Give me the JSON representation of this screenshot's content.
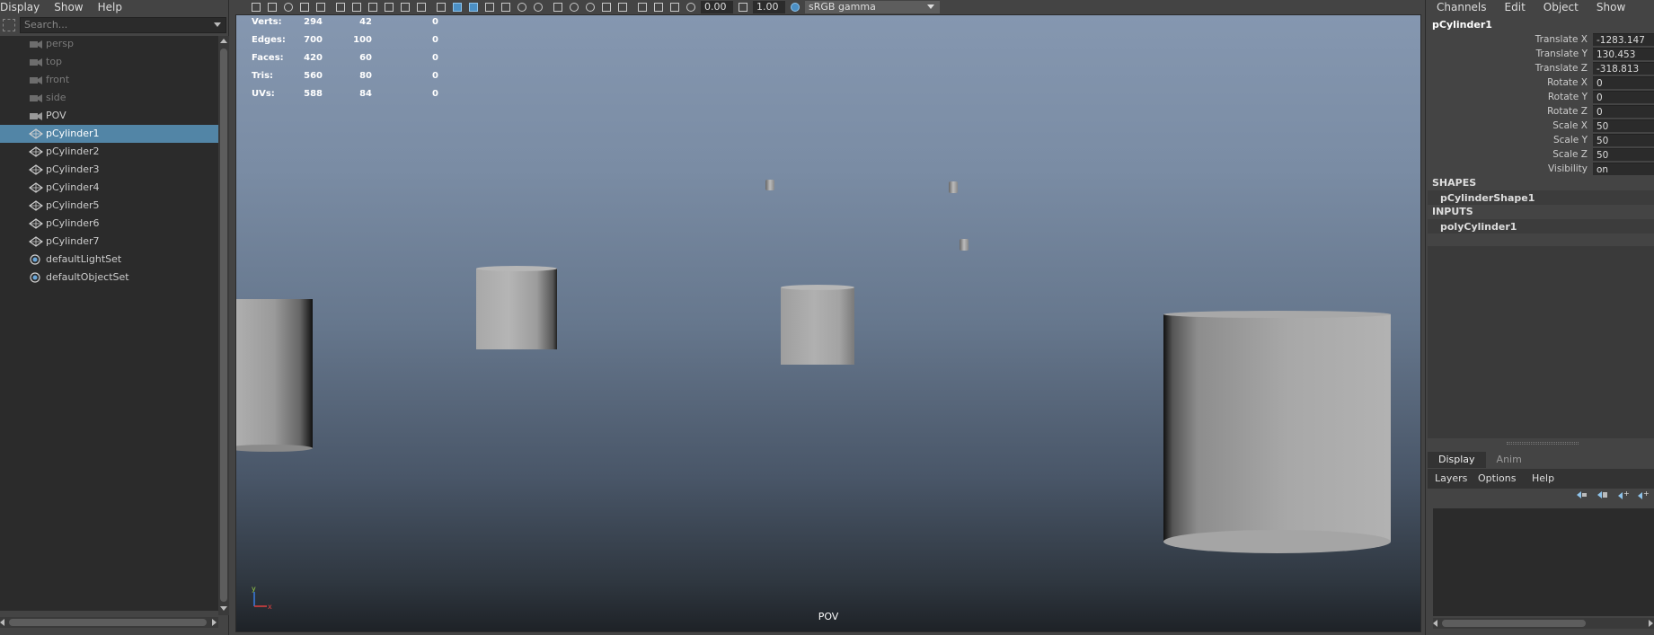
{
  "outliner": {
    "menu": [
      "Display",
      "Show",
      "Help"
    ],
    "search_placeholder": "Search...",
    "items": [
      {
        "label": "persp",
        "icon": "camera-icon",
        "dim": true
      },
      {
        "label": "top",
        "icon": "camera-icon",
        "dim": true
      },
      {
        "label": "front",
        "icon": "camera-icon",
        "dim": true
      },
      {
        "label": "side",
        "icon": "camera-icon",
        "dim": true
      },
      {
        "label": "POV",
        "icon": "camera-icon",
        "dim": false
      },
      {
        "label": "pCylinder1",
        "icon": "mesh-icon",
        "selected": true
      },
      {
        "label": "pCylinder2",
        "icon": "mesh-icon"
      },
      {
        "label": "pCylinder3",
        "icon": "mesh-icon"
      },
      {
        "label": "pCylinder4",
        "icon": "mesh-icon"
      },
      {
        "label": "pCylinder5",
        "icon": "mesh-icon"
      },
      {
        "label": "pCylinder6",
        "icon": "mesh-icon"
      },
      {
        "label": "pCylinder7",
        "icon": "mesh-icon"
      },
      {
        "label": "defaultLightSet",
        "icon": "set-icon"
      },
      {
        "label": "defaultObjectSet",
        "icon": "set-icon"
      }
    ]
  },
  "toolbar": {
    "exposure": "0.00",
    "gamma": "1.00",
    "color_space": "sRGB gamma"
  },
  "viewport": {
    "camera_label": "POV",
    "hud": [
      {
        "label": "Verts:",
        "values": [
          "294",
          "42",
          "0"
        ]
      },
      {
        "label": "Edges:",
        "values": [
          "700",
          "100",
          "0"
        ]
      },
      {
        "label": "Faces:",
        "values": [
          "420",
          "60",
          "0"
        ]
      },
      {
        "label": "Tris:",
        "values": [
          "560",
          "80",
          "0"
        ]
      },
      {
        "label": "UVs:",
        "values": [
          "588",
          "84",
          "0"
        ]
      }
    ],
    "axis": {
      "y": "y",
      "x": "x"
    }
  },
  "channelbox": {
    "menu": [
      "Channels",
      "Edit",
      "Object",
      "Show"
    ],
    "object_name": "pCylinder1",
    "attributes": [
      {
        "name": "Translate X",
        "value": "-1283.147"
      },
      {
        "name": "Translate Y",
        "value": "130.453"
      },
      {
        "name": "Translate Z",
        "value": "-318.813"
      },
      {
        "name": "Rotate X",
        "value": "0"
      },
      {
        "name": "Rotate Y",
        "value": "0"
      },
      {
        "name": "Rotate Z",
        "value": "0"
      },
      {
        "name": "Scale X",
        "value": "50"
      },
      {
        "name": "Scale Y",
        "value": "50"
      },
      {
        "name": "Scale Z",
        "value": "50"
      },
      {
        "name": "Visibility",
        "value": "on"
      }
    ],
    "shapes_header": "SHAPES",
    "shape_node": "pCylinderShape1",
    "inputs_header": "INPUTS",
    "input_node": "polyCylinder1"
  },
  "layer_editor": {
    "tabs": [
      "Display",
      "Anim"
    ],
    "menu": [
      "Layers",
      "Options",
      "Help"
    ]
  },
  "colors": {
    "selection": "#5285a6",
    "panel_bg": "#444444",
    "field_bg": "#2b2b2b"
  }
}
